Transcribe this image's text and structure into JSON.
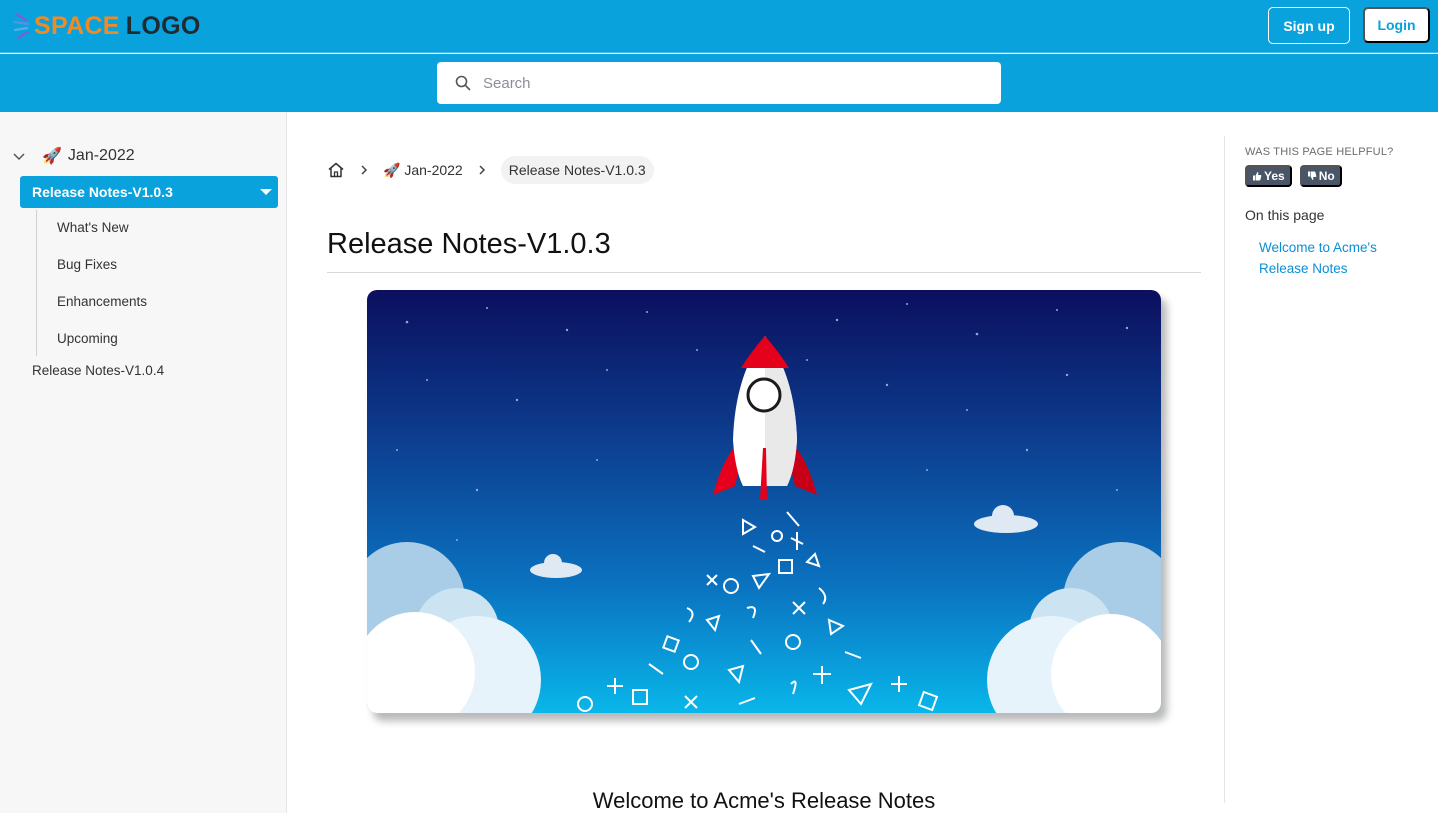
{
  "header": {
    "logo_space": "SPACE",
    "logo_logo": "LOGO",
    "signup_label": "Sign up",
    "login_label": "Login",
    "brand_color": "#0aa2dd",
    "logo_orange": "#f08a24"
  },
  "search": {
    "placeholder": "Search",
    "icon": "search-icon"
  },
  "sidebar": {
    "group_label": "Jan-2022",
    "group_icon": "🚀",
    "active_item": "Release Notes-V1.0.3",
    "sub_items": [
      "What's New",
      "Bug Fixes",
      "Enhancements",
      "Upcoming"
    ],
    "next_item": "Release Notes-V1.0.4"
  },
  "breadcrumb": {
    "home_icon": "home-icon",
    "group_icon": "🚀",
    "group": "Jan-2022",
    "current": "Release Notes-V1.0.3"
  },
  "main": {
    "title": "Release Notes-V1.0.3",
    "welcome_heading": "Welcome to Acme's Release Notes"
  },
  "toc": {
    "helpful_label": "WAS THIS PAGE HELPFUL?",
    "yes_label": "Yes",
    "no_label": "No",
    "on_this_page": "On this page",
    "link": "Welcome to Acme's Release Notes"
  }
}
